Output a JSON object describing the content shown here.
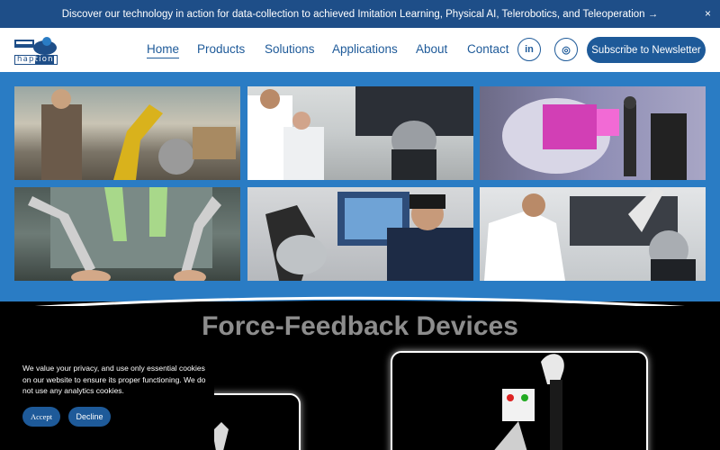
{
  "announcement": {
    "text": "Discover our technology in action for data-collection to achieved Imitation Learning, Physical AI, Telerobotics, and Teleoperation →",
    "close": "×"
  },
  "logo": {
    "text_a": "hap",
    "text_b": "tion"
  },
  "nav": {
    "items": [
      "Home",
      "Products",
      "Solutions",
      "Applications",
      "About",
      "Contact"
    ],
    "linkedin": "in",
    "instagram": "◎",
    "subscribe": "Subscribe to Newsletter"
  },
  "gallery": {
    "photos": [
      "operator-with-industrial-robot-arm",
      "engineers-at-teleoperation-workstation",
      "vr-user-with-virtual-engine-model",
      "dual-haptic-arms-over-screen",
      "vr-headset-user-with-haptic-device",
      "doctor-using-haptic-arm"
    ]
  },
  "section": {
    "title": "Force-Feedback Devices"
  },
  "cookie": {
    "text": "We value your privacy, and use only essential cookies on our website to ensure its proper functioning. We do not use any analytics cookies.",
    "accept": "Accept",
    "decline": "Decline"
  },
  "colors": {
    "brand": "#1e5a99",
    "announce": "#1e4e88",
    "gallery_bg": "#2a7cc4"
  }
}
